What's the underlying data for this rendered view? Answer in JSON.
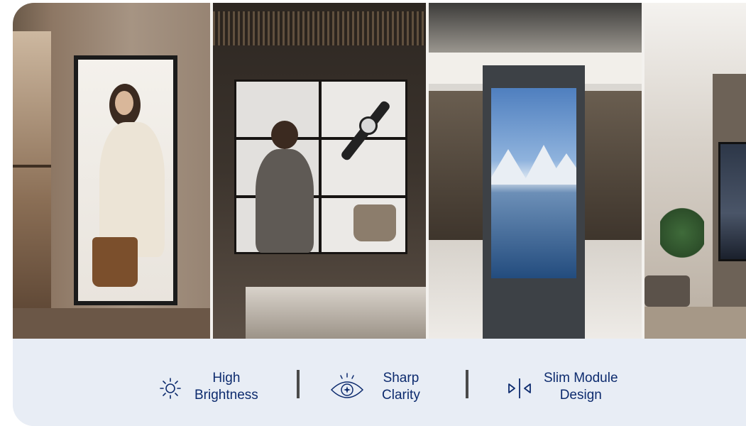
{
  "features": [
    {
      "line1": "High",
      "line2": "Brightness",
      "icon": "sun-icon"
    },
    {
      "line1": "Sharp",
      "line2": "Clarity",
      "icon": "eye-icon"
    },
    {
      "line1": "Slim Module",
      "line2": "Design",
      "icon": "slim-module-icon"
    }
  ],
  "colors": {
    "text": "#0d2b6e",
    "bar_background": "#e8edf5",
    "separator": "#4a4a4a"
  }
}
